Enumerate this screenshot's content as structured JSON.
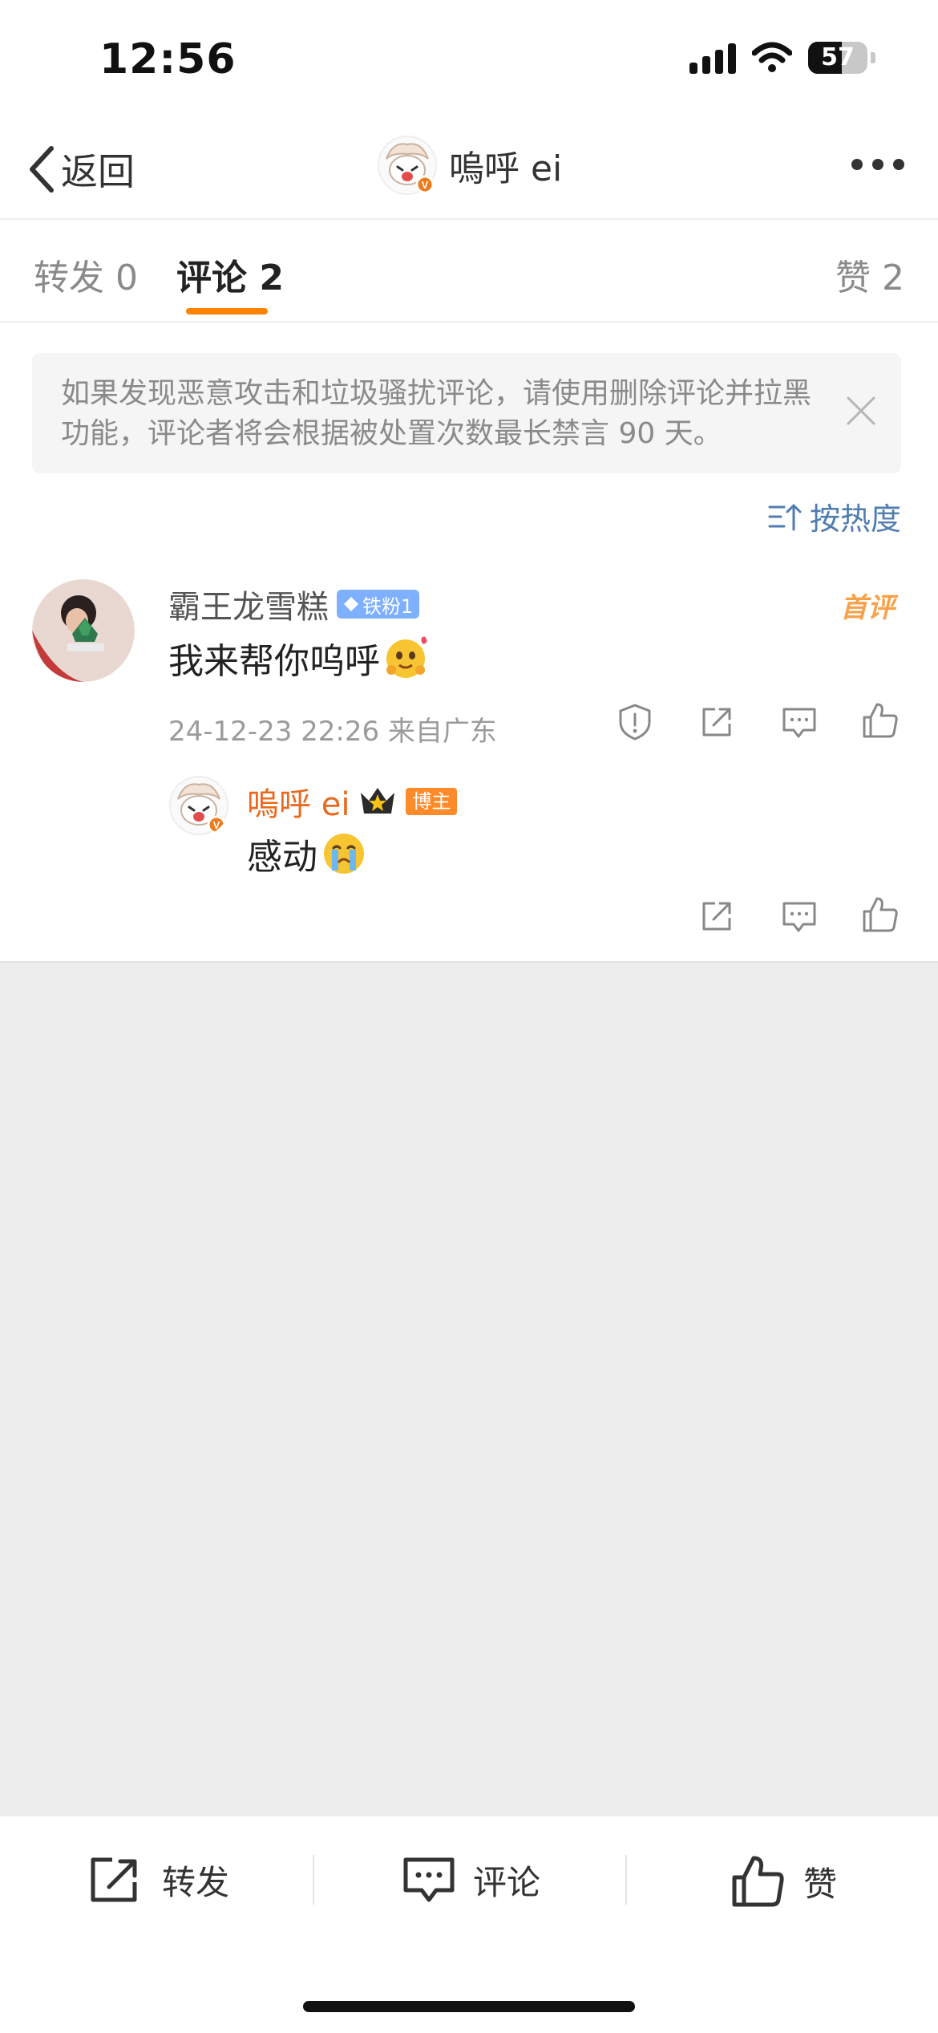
{
  "status_bar": {
    "time": "12:56",
    "battery": "57",
    "battery_level": 0.57
  },
  "nav": {
    "back_label": "返回",
    "title": "嗚呼 ei"
  },
  "tabs": {
    "repost": "转发 0",
    "comment": "评论 2",
    "like": "赞 2"
  },
  "notice": {
    "text": "如果发现恶意攻击和垃圾骚扰评论，请使用删除评论并拉黑功能，评论者将会根据被处置次数最长禁言 90 天。"
  },
  "sort": {
    "label": "按热度"
  },
  "comment": {
    "user": "霸王龙雪糕",
    "fan_badge": "铁粉1",
    "first_badge": "首评",
    "text": "我来帮你呜呼",
    "meta": "24-12-23 22:26 来自广东"
  },
  "reply": {
    "user": "嗚呼 ei",
    "host_badge": "博主",
    "text": "感动"
  },
  "bottom": {
    "repost": "转发",
    "comment": "评论",
    "like": "赞"
  },
  "colors": {
    "accent": "#ff8200",
    "link": "#507daf",
    "host_name": "#e86a1e"
  }
}
